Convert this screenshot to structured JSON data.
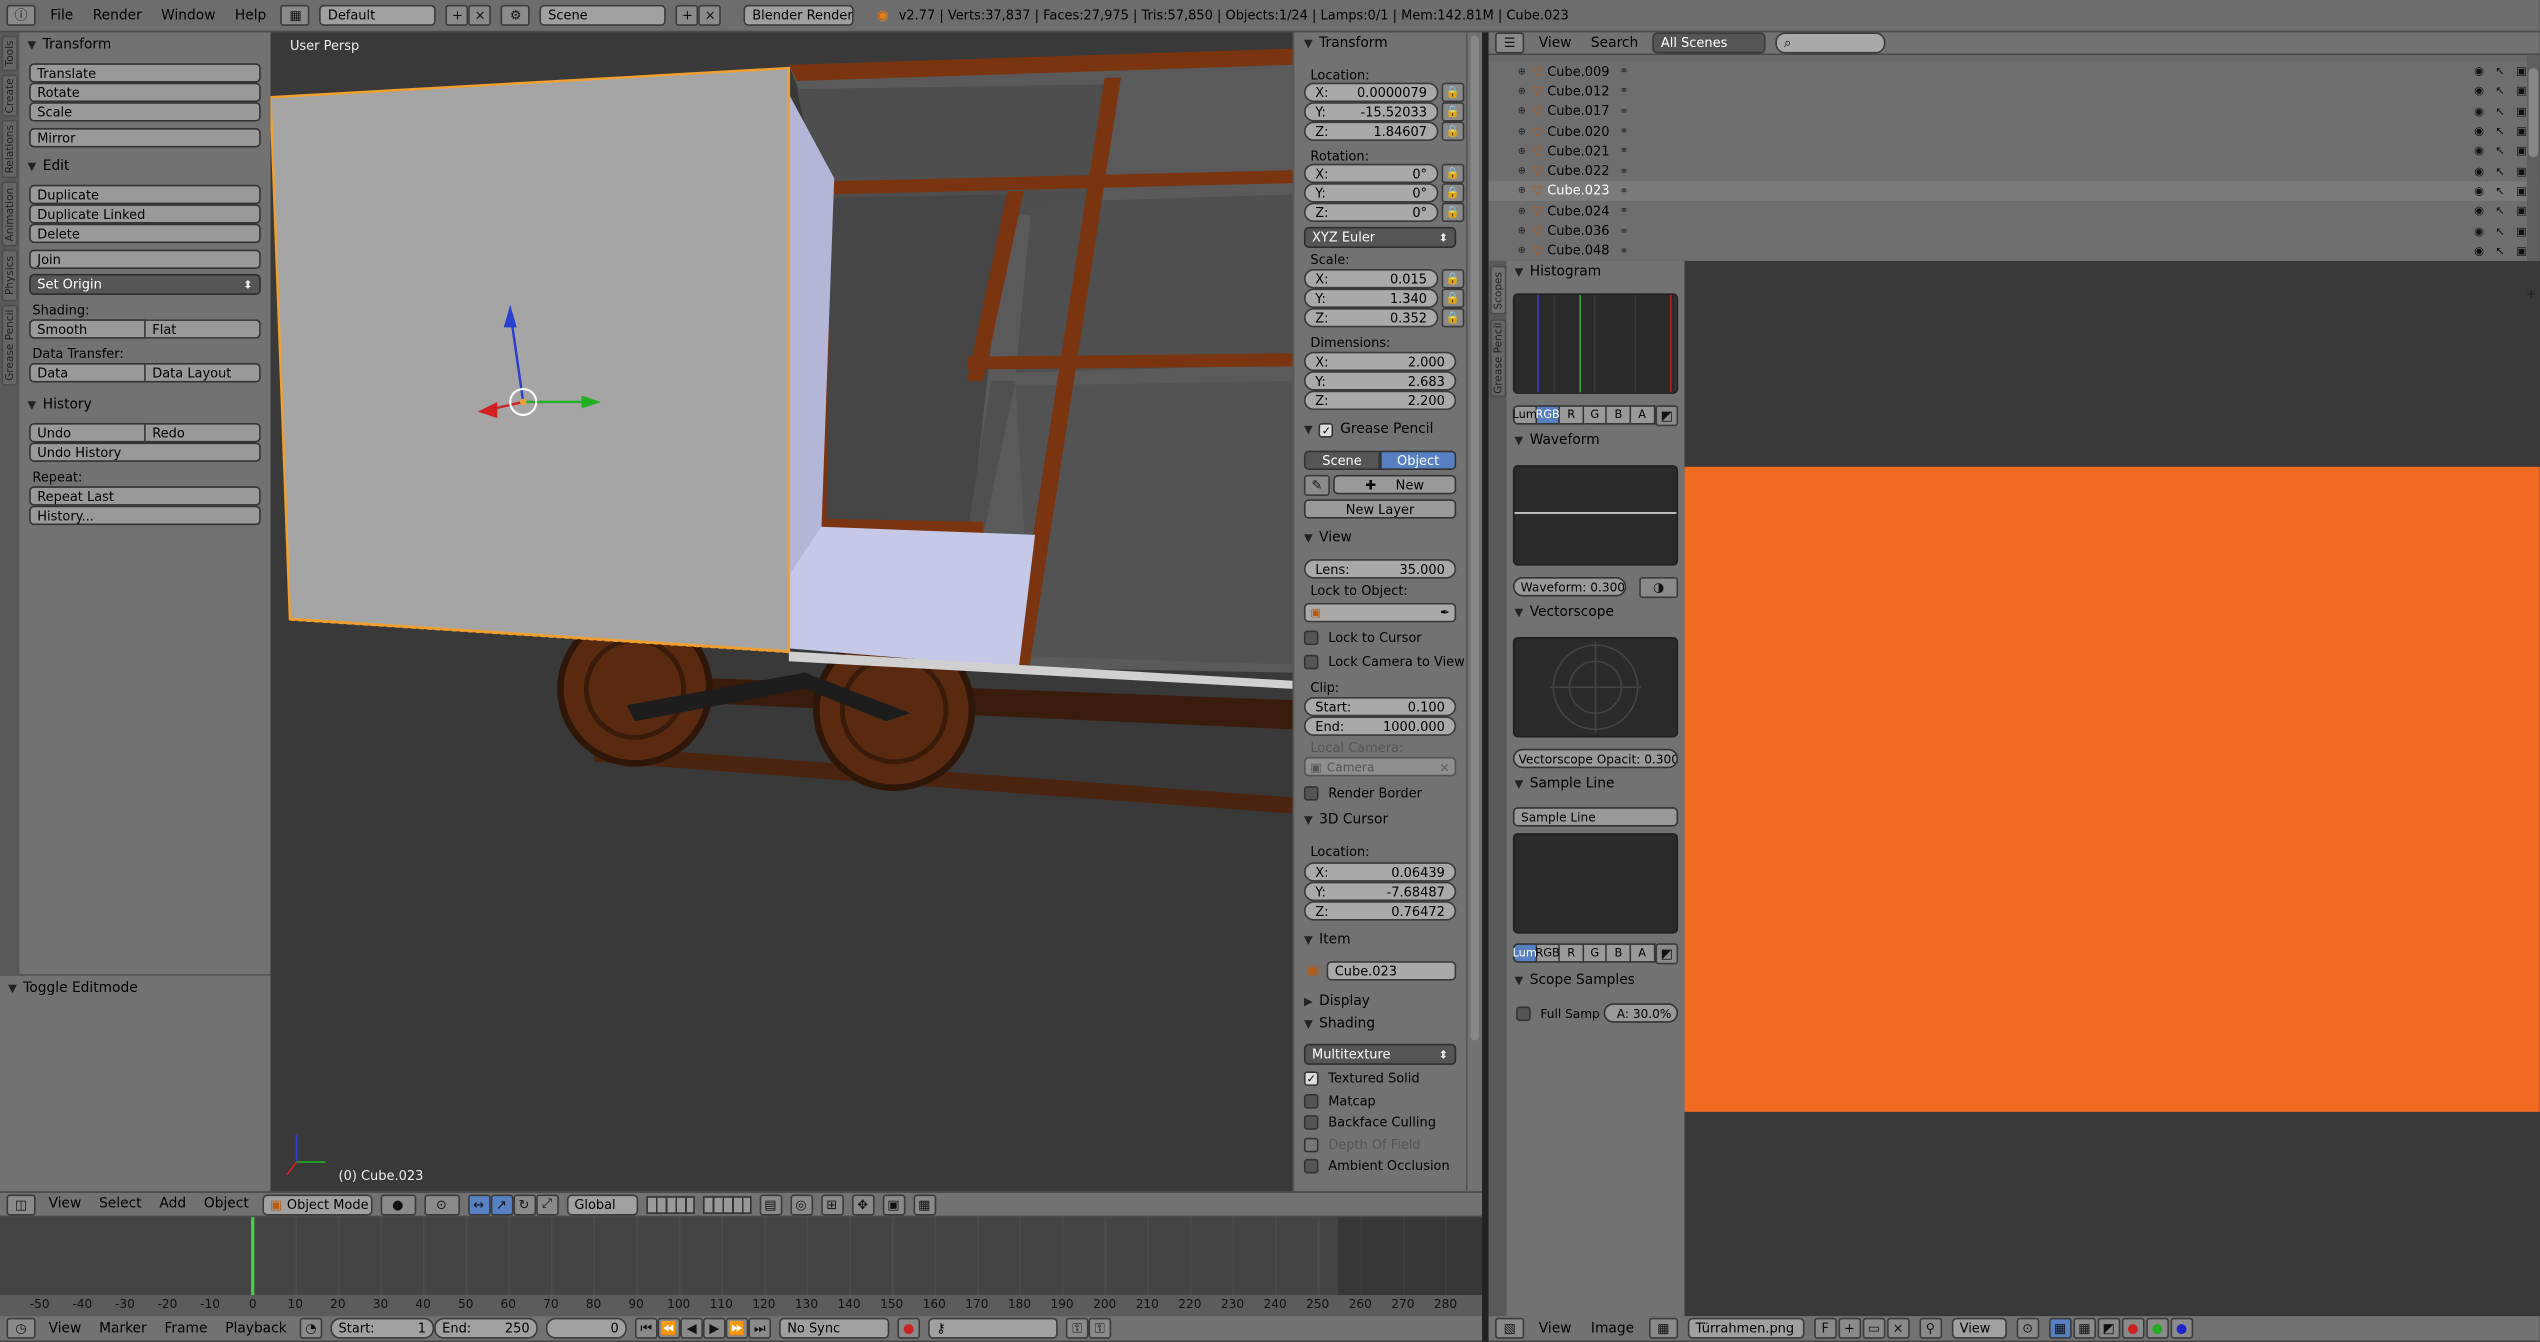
{
  "topbar": {
    "menus": [
      "File",
      "Render",
      "Window",
      "Help"
    ],
    "screen_layout": "Default",
    "scene": "Scene",
    "engine": "Blender Render",
    "stats": "v2.77 | Verts:37,837 | Faces:27,975 | Tris:57,850 | Objects:1/24 | Lamps:0/1 | Mem:142.81M | Cube.023"
  },
  "toolshelf": {
    "tabs": [
      "Tools",
      "Create",
      "Relations",
      "Animation",
      "Physics",
      "Grease Pencil"
    ],
    "transform": {
      "title": "Transform",
      "translate": "Translate",
      "rotate": "Rotate",
      "scale": "Scale",
      "mirror": "Mirror"
    },
    "edit": {
      "title": "Edit",
      "duplicate": "Duplicate",
      "duplicate_linked": "Duplicate Linked",
      "delete": "Delete",
      "join": "Join",
      "set_origin": "Set Origin",
      "shading_label": "Shading:",
      "smooth": "Smooth",
      "flat": "Flat",
      "data_transfer_label": "Data Transfer:",
      "data": "Data",
      "data_layout": "Data Layout"
    },
    "history": {
      "title": "History",
      "undo": "Undo",
      "redo": "Redo",
      "undo_history": "Undo History",
      "repeat_label": "Repeat:",
      "repeat_last": "Repeat Last",
      "history": "History..."
    },
    "operator": "Toggle Editmode"
  },
  "viewport": {
    "view_name": "User Persp",
    "object_label": "(0) Cube.023"
  },
  "properties": {
    "transform_title": "Transform",
    "location_label": "Location:",
    "location": {
      "x": "0.0000079",
      "y": "-15.52033",
      "z": "1.84607"
    },
    "rotation_label": "Rotation:",
    "rotation": {
      "x": "0°",
      "y": "0°",
      "z": "0°"
    },
    "rotation_mode": "XYZ Euler",
    "scale_label": "Scale:",
    "scale": {
      "x": "0.015",
      "y": "1.340",
      "z": "0.352"
    },
    "dimensions_label": "Dimensions:",
    "dimensions": {
      "x": "2.000",
      "y": "2.683",
      "z": "2.200"
    },
    "grease_pencil": {
      "title": "Grease Pencil",
      "scene": "Scene",
      "object": "Object",
      "new": "New",
      "new_layer": "New Layer"
    },
    "view": {
      "title": "View",
      "lens_label": "Lens:",
      "lens": "35.000",
      "lock_to_object": "Lock to Object:",
      "lock_to_cursor": "Lock to Cursor",
      "lock_camera": "Lock Camera to View",
      "clip_label": "Clip:",
      "clip_start_label": "Start:",
      "clip_start": "0.100",
      "clip_end_label": "End:",
      "clip_end": "1000.000",
      "local_camera": "Local Camera:",
      "camera": "Camera",
      "render_border": "Render Border"
    },
    "cursor": {
      "title": "3D Cursor",
      "location_label": "Location:",
      "x": "0.06439",
      "y": "-7.68487",
      "z": "0.76472"
    },
    "item": {
      "title": "Item",
      "name": "Cube.023"
    },
    "display_title": "Display",
    "shading": {
      "title": "Shading",
      "mode": "Multitexture",
      "textured_solid": "Textured Solid",
      "matcap": "Matcap",
      "backface_culling": "Backface Culling",
      "depth_of_field": "Depth Of Field",
      "ambient_occlusion": "Ambient Occlusion"
    }
  },
  "viewport_header": {
    "menus": [
      "View",
      "Select",
      "Add",
      "Object"
    ],
    "mode": "Object Mode",
    "orientation": "Global"
  },
  "timeline": {
    "ticks": [
      "-50",
      "-40",
      "-30",
      "-20",
      "-10",
      "0",
      "10",
      "20",
      "30",
      "40",
      "50",
      "60",
      "70",
      "80",
      "90",
      "100",
      "110",
      "120",
      "130",
      "140",
      "150",
      "160",
      "170",
      "180",
      "190",
      "200",
      "210",
      "220",
      "230",
      "240",
      "250",
      "260",
      "270",
      "280"
    ],
    "menus": [
      "View",
      "Marker",
      "Frame",
      "Playback"
    ],
    "start_label": "Start:",
    "start": "1",
    "end_label": "End:",
    "end": "250",
    "current": "0",
    "sync": "No Sync"
  },
  "outliner": {
    "menus": [
      "View",
      "Search"
    ],
    "display": "All Scenes",
    "items": [
      "Cube.009",
      "Cube.012",
      "Cube.017",
      "Cube.020",
      "Cube.021",
      "Cube.022",
      "Cube.023",
      "Cube.024",
      "Cube.036",
      "Cube.048"
    ],
    "selected": "Cube.023"
  },
  "scopes": {
    "tabs": [
      "Scopes",
      "Grease Pencil"
    ],
    "histogram_title": "Histogram",
    "channels": [
      "Lum",
      "RGB",
      "R",
      "G",
      "B",
      "A"
    ],
    "waveform_title": "Waveform",
    "waveform_opacity": "Waveform: 0.300",
    "vectorscope_title": "Vectorscope",
    "vectorscope_opacity": "Vectorscope Opacit: 0.300",
    "sample_line_title": "Sample Line",
    "sample_line_button": "Sample Line",
    "scope_samples_title": "Scope Samples",
    "full_sample": "Full Samp",
    "accuracy": "A: 30.0%"
  },
  "image_editor": {
    "menus": [
      "View",
      "Image"
    ],
    "image_name": "Türrahmen.png",
    "image_color": "#f06a22",
    "view": "View"
  },
  "colors": {
    "accent": "#5680c2",
    "selection": "#f0a030",
    "wood": "#7a3410"
  }
}
